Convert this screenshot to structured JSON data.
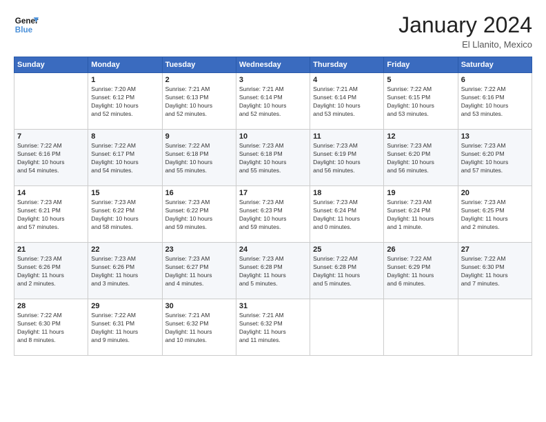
{
  "header": {
    "logo_line1": "General",
    "logo_line2": "Blue",
    "month_title": "January 2024",
    "location": "El Llanito, Mexico"
  },
  "days_of_week": [
    "Sunday",
    "Monday",
    "Tuesday",
    "Wednesday",
    "Thursday",
    "Friday",
    "Saturday"
  ],
  "weeks": [
    [
      {
        "num": "",
        "info": ""
      },
      {
        "num": "1",
        "info": "Sunrise: 7:20 AM\nSunset: 6:12 PM\nDaylight: 10 hours\nand 52 minutes."
      },
      {
        "num": "2",
        "info": "Sunrise: 7:21 AM\nSunset: 6:13 PM\nDaylight: 10 hours\nand 52 minutes."
      },
      {
        "num": "3",
        "info": "Sunrise: 7:21 AM\nSunset: 6:14 PM\nDaylight: 10 hours\nand 52 minutes."
      },
      {
        "num": "4",
        "info": "Sunrise: 7:21 AM\nSunset: 6:14 PM\nDaylight: 10 hours\nand 53 minutes."
      },
      {
        "num": "5",
        "info": "Sunrise: 7:22 AM\nSunset: 6:15 PM\nDaylight: 10 hours\nand 53 minutes."
      },
      {
        "num": "6",
        "info": "Sunrise: 7:22 AM\nSunset: 6:16 PM\nDaylight: 10 hours\nand 53 minutes."
      }
    ],
    [
      {
        "num": "7",
        "info": "Sunrise: 7:22 AM\nSunset: 6:16 PM\nDaylight: 10 hours\nand 54 minutes."
      },
      {
        "num": "8",
        "info": "Sunrise: 7:22 AM\nSunset: 6:17 PM\nDaylight: 10 hours\nand 54 minutes."
      },
      {
        "num": "9",
        "info": "Sunrise: 7:22 AM\nSunset: 6:18 PM\nDaylight: 10 hours\nand 55 minutes."
      },
      {
        "num": "10",
        "info": "Sunrise: 7:23 AM\nSunset: 6:18 PM\nDaylight: 10 hours\nand 55 minutes."
      },
      {
        "num": "11",
        "info": "Sunrise: 7:23 AM\nSunset: 6:19 PM\nDaylight: 10 hours\nand 56 minutes."
      },
      {
        "num": "12",
        "info": "Sunrise: 7:23 AM\nSunset: 6:20 PM\nDaylight: 10 hours\nand 56 minutes."
      },
      {
        "num": "13",
        "info": "Sunrise: 7:23 AM\nSunset: 6:20 PM\nDaylight: 10 hours\nand 57 minutes."
      }
    ],
    [
      {
        "num": "14",
        "info": "Sunrise: 7:23 AM\nSunset: 6:21 PM\nDaylight: 10 hours\nand 57 minutes."
      },
      {
        "num": "15",
        "info": "Sunrise: 7:23 AM\nSunset: 6:22 PM\nDaylight: 10 hours\nand 58 minutes."
      },
      {
        "num": "16",
        "info": "Sunrise: 7:23 AM\nSunset: 6:22 PM\nDaylight: 10 hours\nand 59 minutes."
      },
      {
        "num": "17",
        "info": "Sunrise: 7:23 AM\nSunset: 6:23 PM\nDaylight: 10 hours\nand 59 minutes."
      },
      {
        "num": "18",
        "info": "Sunrise: 7:23 AM\nSunset: 6:24 PM\nDaylight: 11 hours\nand 0 minutes."
      },
      {
        "num": "19",
        "info": "Sunrise: 7:23 AM\nSunset: 6:24 PM\nDaylight: 11 hours\nand 1 minute."
      },
      {
        "num": "20",
        "info": "Sunrise: 7:23 AM\nSunset: 6:25 PM\nDaylight: 11 hours\nand 2 minutes."
      }
    ],
    [
      {
        "num": "21",
        "info": "Sunrise: 7:23 AM\nSunset: 6:26 PM\nDaylight: 11 hours\nand 2 minutes."
      },
      {
        "num": "22",
        "info": "Sunrise: 7:23 AM\nSunset: 6:26 PM\nDaylight: 11 hours\nand 3 minutes."
      },
      {
        "num": "23",
        "info": "Sunrise: 7:23 AM\nSunset: 6:27 PM\nDaylight: 11 hours\nand 4 minutes."
      },
      {
        "num": "24",
        "info": "Sunrise: 7:23 AM\nSunset: 6:28 PM\nDaylight: 11 hours\nand 5 minutes."
      },
      {
        "num": "25",
        "info": "Sunrise: 7:22 AM\nSunset: 6:28 PM\nDaylight: 11 hours\nand 5 minutes."
      },
      {
        "num": "26",
        "info": "Sunrise: 7:22 AM\nSunset: 6:29 PM\nDaylight: 11 hours\nand 6 minutes."
      },
      {
        "num": "27",
        "info": "Sunrise: 7:22 AM\nSunset: 6:30 PM\nDaylight: 11 hours\nand 7 minutes."
      }
    ],
    [
      {
        "num": "28",
        "info": "Sunrise: 7:22 AM\nSunset: 6:30 PM\nDaylight: 11 hours\nand 8 minutes."
      },
      {
        "num": "29",
        "info": "Sunrise: 7:22 AM\nSunset: 6:31 PM\nDaylight: 11 hours\nand 9 minutes."
      },
      {
        "num": "30",
        "info": "Sunrise: 7:21 AM\nSunset: 6:32 PM\nDaylight: 11 hours\nand 10 minutes."
      },
      {
        "num": "31",
        "info": "Sunrise: 7:21 AM\nSunset: 6:32 PM\nDaylight: 11 hours\nand 11 minutes."
      },
      {
        "num": "",
        "info": ""
      },
      {
        "num": "",
        "info": ""
      },
      {
        "num": "",
        "info": ""
      }
    ]
  ]
}
